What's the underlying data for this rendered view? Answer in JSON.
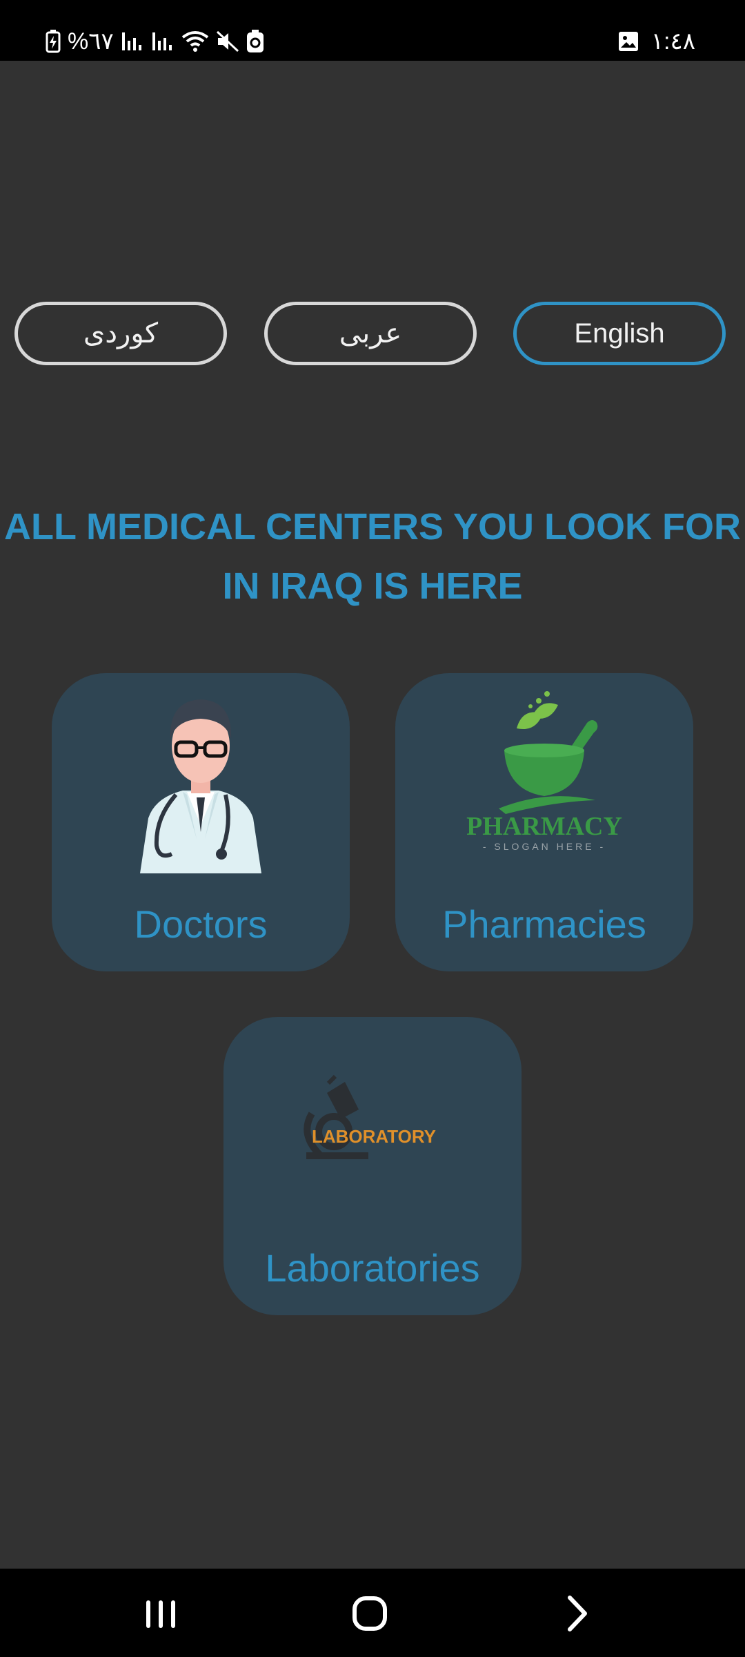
{
  "status_bar": {
    "battery_percent": "%٦٧",
    "time": "١:٤٨"
  },
  "languages": [
    {
      "label": "کوردی",
      "active": false
    },
    {
      "label": "عربی",
      "active": false
    },
    {
      "label": "English",
      "active": true
    }
  ],
  "headline": {
    "line1": "ALL MEDICAL CENTERS YOU LOOK FOR",
    "line2": "IN IRAQ IS HERE"
  },
  "cards": {
    "doctors": {
      "label": "Doctors"
    },
    "pharmacies": {
      "label": "Pharmacies",
      "logo_text": "PHARMACY",
      "logo_slogan": "- SLOGAN HERE -"
    },
    "laboratories": {
      "label": "Laboratories",
      "logo_text": "LABORATORY"
    }
  },
  "colors": {
    "accent": "#2f93c6",
    "background": "#323232",
    "card": "#2f4553"
  },
  "icons": {
    "status": [
      "battery-charging-icon",
      "signal-icon",
      "signal-icon",
      "wifi-icon",
      "mute-icon",
      "accessibility-icon",
      "gallery-icon"
    ],
    "nav": [
      "recents-icon",
      "home-icon",
      "back-icon"
    ]
  }
}
